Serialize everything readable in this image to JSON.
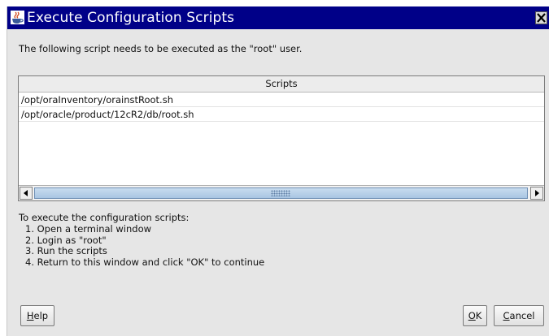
{
  "window": {
    "title": "Execute Configuration Scripts",
    "icon": "java-cup-icon",
    "close_icon": "close-x-icon"
  },
  "intro_text": "The following script needs to be executed as the \"root\" user.",
  "table": {
    "header": "Scripts",
    "rows": [
      "/opt/oraInventory/orainstRoot.sh",
      "/opt/oracle/product/12cR2/db/root.sh"
    ],
    "scrollbar": {
      "left_icon": "arrow-left-icon",
      "right_icon": "arrow-right-icon"
    }
  },
  "instructions": {
    "heading": "To execute the configuration scripts:",
    "steps": [
      "1. Open a terminal window",
      "2. Login as \"root\"",
      "3. Run the scripts",
      "4. Return to this window and click \"OK\" to continue"
    ]
  },
  "buttons": {
    "help": {
      "mnemonic": "H",
      "rest": "elp"
    },
    "ok": {
      "mnemonic": "O",
      "rest": "K"
    },
    "cancel": {
      "mnemonic": "C",
      "rest": "ancel"
    }
  },
  "colors": {
    "titlebar": "#000088",
    "dialog_bg": "#e6e6e6",
    "scroll_thumb": "#a9c5e3"
  }
}
